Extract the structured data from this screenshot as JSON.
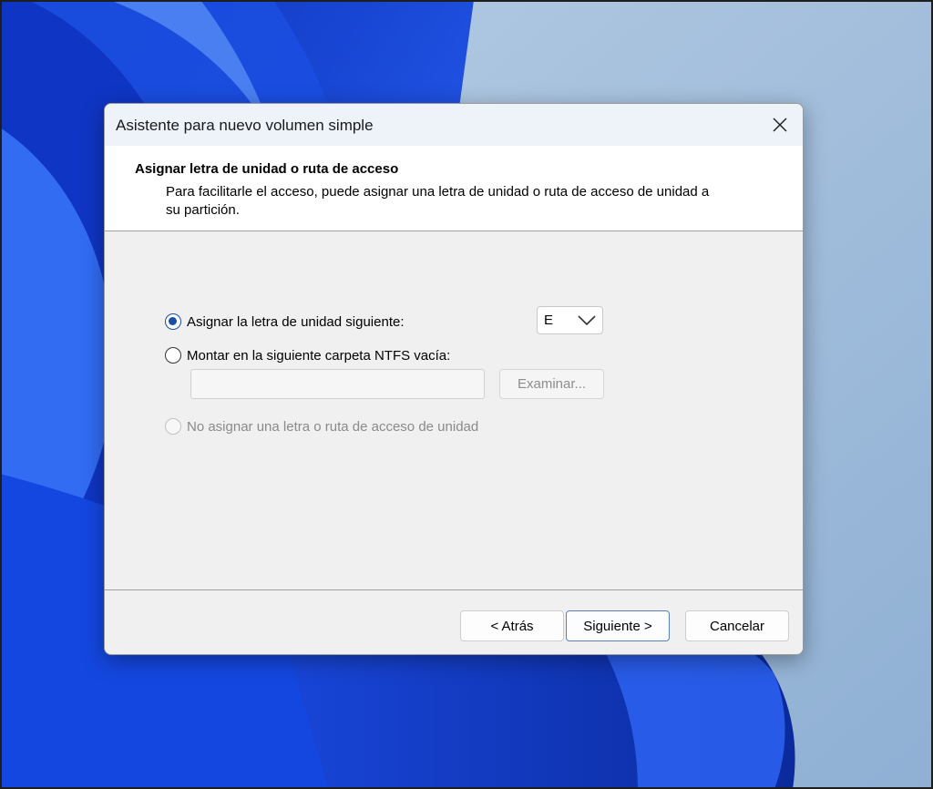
{
  "window": {
    "title": "Asistente para nuevo volumen simple"
  },
  "header": {
    "title": "Asignar letra de unidad o ruta de acceso",
    "description": "Para facilitarle el acceso, puede asignar una letra de unidad o ruta de acceso de unidad a su partición."
  },
  "options": {
    "assign_letter": {
      "label": "Asignar la letra de unidad siguiente:",
      "selected": true
    },
    "mount_folder": {
      "label": "Montar en la siguiente carpeta NTFS vacía:",
      "selected": false
    },
    "no_assign": {
      "label": "No asignar una letra o ruta de acceso de unidad",
      "selected": false,
      "disabled": true
    }
  },
  "drive_letter": {
    "value": "E"
  },
  "folder_path": {
    "value": ""
  },
  "browse_label": "Examinar...",
  "buttons": {
    "back": "< Atrás",
    "next": "Siguiente >",
    "cancel": "Cancelar"
  },
  "colors": {
    "accent": "#1b4fa3",
    "wallpaper_blue": "#1a44d6",
    "wallpaper_sky": "#a9c0d9"
  },
  "icons": [
    "close-icon",
    "chevron-down-icon"
  ]
}
